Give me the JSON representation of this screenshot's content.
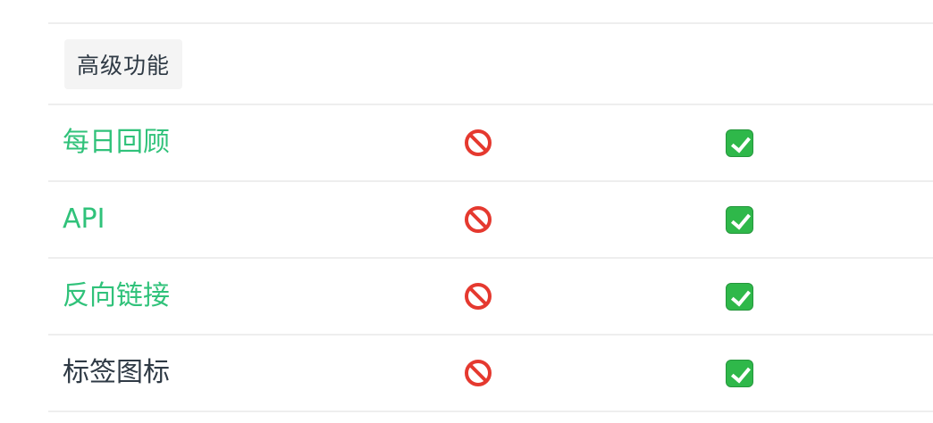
{
  "section": {
    "label": "高级功能"
  },
  "rows": [
    {
      "feature": "每日回顾",
      "is_link": true,
      "free": "no-entry-icon",
      "pro": "check-mark-icon"
    },
    {
      "feature": "API",
      "is_link": true,
      "free": "no-entry-icon",
      "pro": "check-mark-icon"
    },
    {
      "feature": "反向链接",
      "is_link": true,
      "free": "no-entry-icon",
      "pro": "check-mark-icon"
    },
    {
      "feature": "标签图标",
      "is_link": false,
      "free": "no-entry-icon",
      "pro": "check-mark-icon"
    }
  ],
  "colors": {
    "link": "#30c27a",
    "text": "#2f3a45",
    "divider": "#eeeeee",
    "no_entry": "#e5392f",
    "check": "#2fb84a"
  }
}
